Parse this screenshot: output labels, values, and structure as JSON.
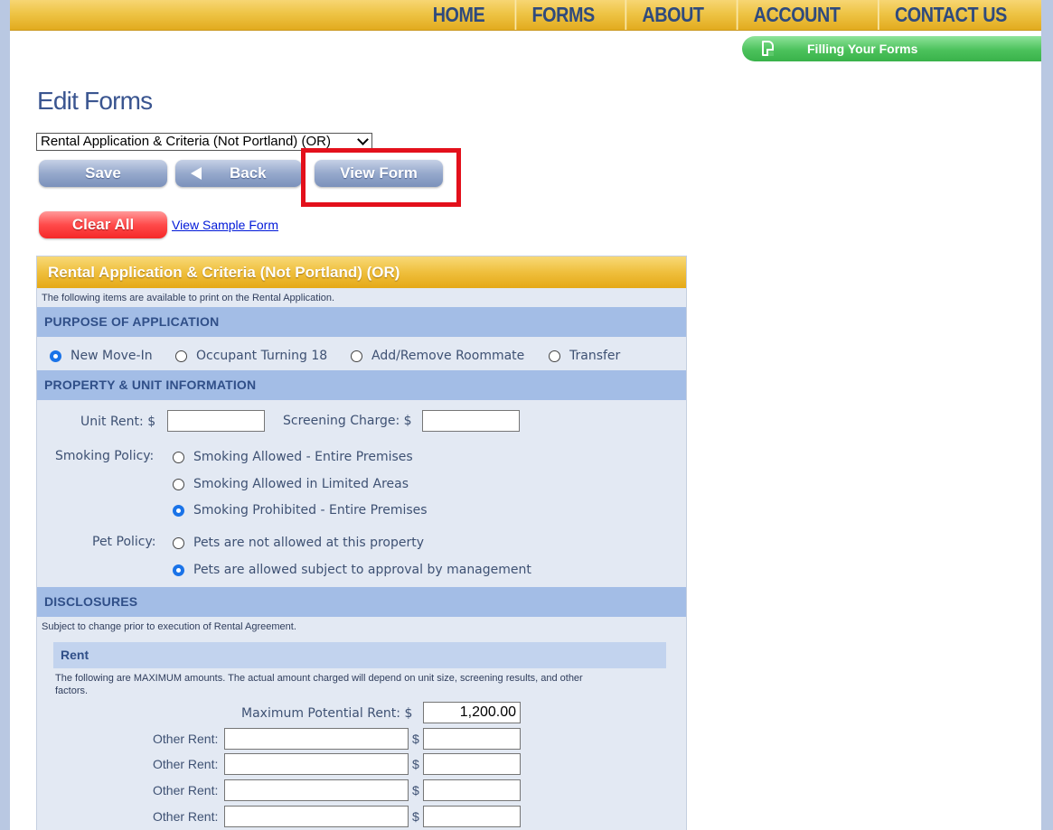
{
  "nav": {
    "items": [
      "HOME",
      "FORMS",
      "ABOUT",
      "ACCOUNT",
      "CONTACT US"
    ]
  },
  "help_tab": {
    "label": "Filling Your Forms",
    "icon": "document-icon"
  },
  "page": {
    "title": "Edit Forms",
    "form_select_value": "Rental Application & Criteria (Not Portland) (OR)"
  },
  "buttons": {
    "save": "Save",
    "back": "Back",
    "view_form": "View Form",
    "clear_all": "Clear All",
    "view_sample": "View Sample Form"
  },
  "panel": {
    "title": "Rental Application & Criteria (Not Portland) (OR)",
    "intro": "The following items are available to print on the Rental Application.",
    "purpose": {
      "heading": "PURPOSE OF APPLICATION",
      "options": [
        "New Move-In",
        "Occupant Turning 18",
        "Add/Remove Roommate",
        "Transfer"
      ],
      "selected": "New Move-In"
    },
    "property": {
      "heading": "PROPERTY & UNIT INFORMATION",
      "unit_rent_label": "Unit Rent: $",
      "unit_rent_value": "",
      "screening_label": "Screening Charge: $",
      "screening_value": "",
      "smoking_label": "Smoking Policy:",
      "smoking_options": [
        "Smoking Allowed - Entire Premises",
        "Smoking Allowed in Limited Areas",
        "Smoking Prohibited - Entire Premises"
      ],
      "smoking_selected": "Smoking Prohibited - Entire Premises",
      "pet_label": "Pet Policy:",
      "pet_options": [
        "Pets are not allowed at this property",
        "Pets are allowed subject to approval by management"
      ],
      "pet_selected": "Pets are allowed subject to approval by management"
    },
    "disclosures": {
      "heading": "DISCLOSURES",
      "note": "Subject to change prior to execution of Rental Agreement.",
      "rent": {
        "heading": "Rent",
        "note_line1": "The following are MAXIMUM amounts. The actual amount charged will depend on unit size, screening results, and other",
        "note_line2": "factors.",
        "max_rent_label": "Maximum Potential Rent: $",
        "max_rent_value": "1,200.00",
        "other_rent_label": "Other Rent:",
        "dollar": "$"
      }
    }
  }
}
